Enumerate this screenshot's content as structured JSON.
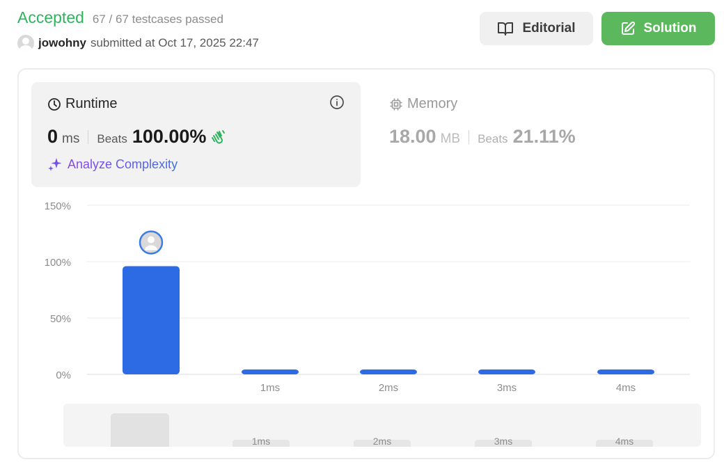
{
  "header": {
    "status": "Accepted",
    "testcases": "67 / 67 testcases passed",
    "username": "jowohny",
    "submitted": "submitted at Oct 17, 2025 22:47"
  },
  "actions": {
    "editorial_label": "Editorial",
    "solution_label": "Solution"
  },
  "runtime": {
    "title": "Runtime",
    "value": "0",
    "unit": "ms",
    "beats_label": "Beats",
    "beats_value": "100.00%",
    "analyze_label": "Analyze Complexity"
  },
  "memory": {
    "title": "Memory",
    "value": "18.00",
    "unit": "MB",
    "beats_label": "Beats",
    "beats_value": "21.11%"
  },
  "colors": {
    "accepted": "#2db55d",
    "solution_button": "#5cb85c",
    "bar": "#2d6be4",
    "analyze_start": "#8b45e6",
    "analyze_end": "#3f6ee8"
  },
  "icons": {
    "editorial": "book-open-icon",
    "solution": "edit-icon",
    "runtime": "clock-icon",
    "info": "info-icon",
    "memory": "chip-icon",
    "beats": "clap-icon",
    "analyze": "sparkle-icon"
  },
  "chart_data": {
    "type": "bar",
    "categories": [
      "",
      "1ms",
      "2ms",
      "3ms",
      "4ms"
    ],
    "values": [
      96,
      3,
      3,
      3,
      3
    ],
    "y_ticks": [
      "0%",
      "50%",
      "100%",
      "150%"
    ],
    "ylim": [
      0,
      150
    ],
    "highlighted_index": 0,
    "grid": true,
    "xlabel": "",
    "ylabel": ""
  },
  "navigator": {
    "labels": [
      "1ms",
      "2ms",
      "3ms",
      "4ms"
    ]
  }
}
